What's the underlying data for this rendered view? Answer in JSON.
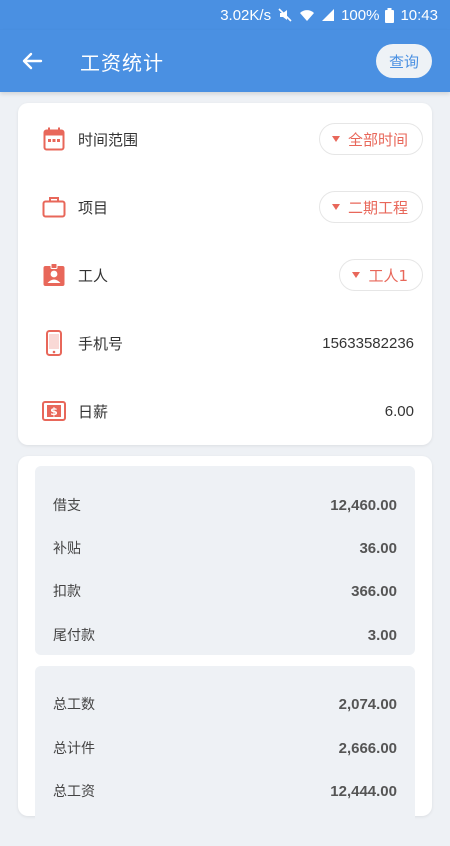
{
  "status": {
    "speed": "3.02K/s",
    "battery": "100%",
    "time": "10:43"
  },
  "appbar": {
    "title": "工资统计",
    "query_label": "查询"
  },
  "filters": {
    "time_range": {
      "label": "时间范围",
      "value": "全部时间"
    },
    "project": {
      "label": "项目",
      "value": "二期工程"
    },
    "worker": {
      "label": "工人",
      "value": "工人1"
    },
    "phone": {
      "label": "手机号",
      "value": "15633582236"
    },
    "daily_wage": {
      "label": "日薪",
      "value": "6.00"
    }
  },
  "summary1": [
    {
      "label": "借支",
      "value": "12,460.00"
    },
    {
      "label": "补贴",
      "value": "36.00"
    },
    {
      "label": "扣款",
      "value": "366.00"
    },
    {
      "label": "尾付款",
      "value": "3.00"
    }
  ],
  "summary2": [
    {
      "label": "总工数",
      "value": "2,074.00"
    },
    {
      "label": "总计件",
      "value": "2,666.00"
    },
    {
      "label": "总工资",
      "value": "12,444.00"
    }
  ],
  "colors": {
    "primary": "#4a90e2",
    "accent": "#e8675a",
    "background": "#eef1f5"
  }
}
